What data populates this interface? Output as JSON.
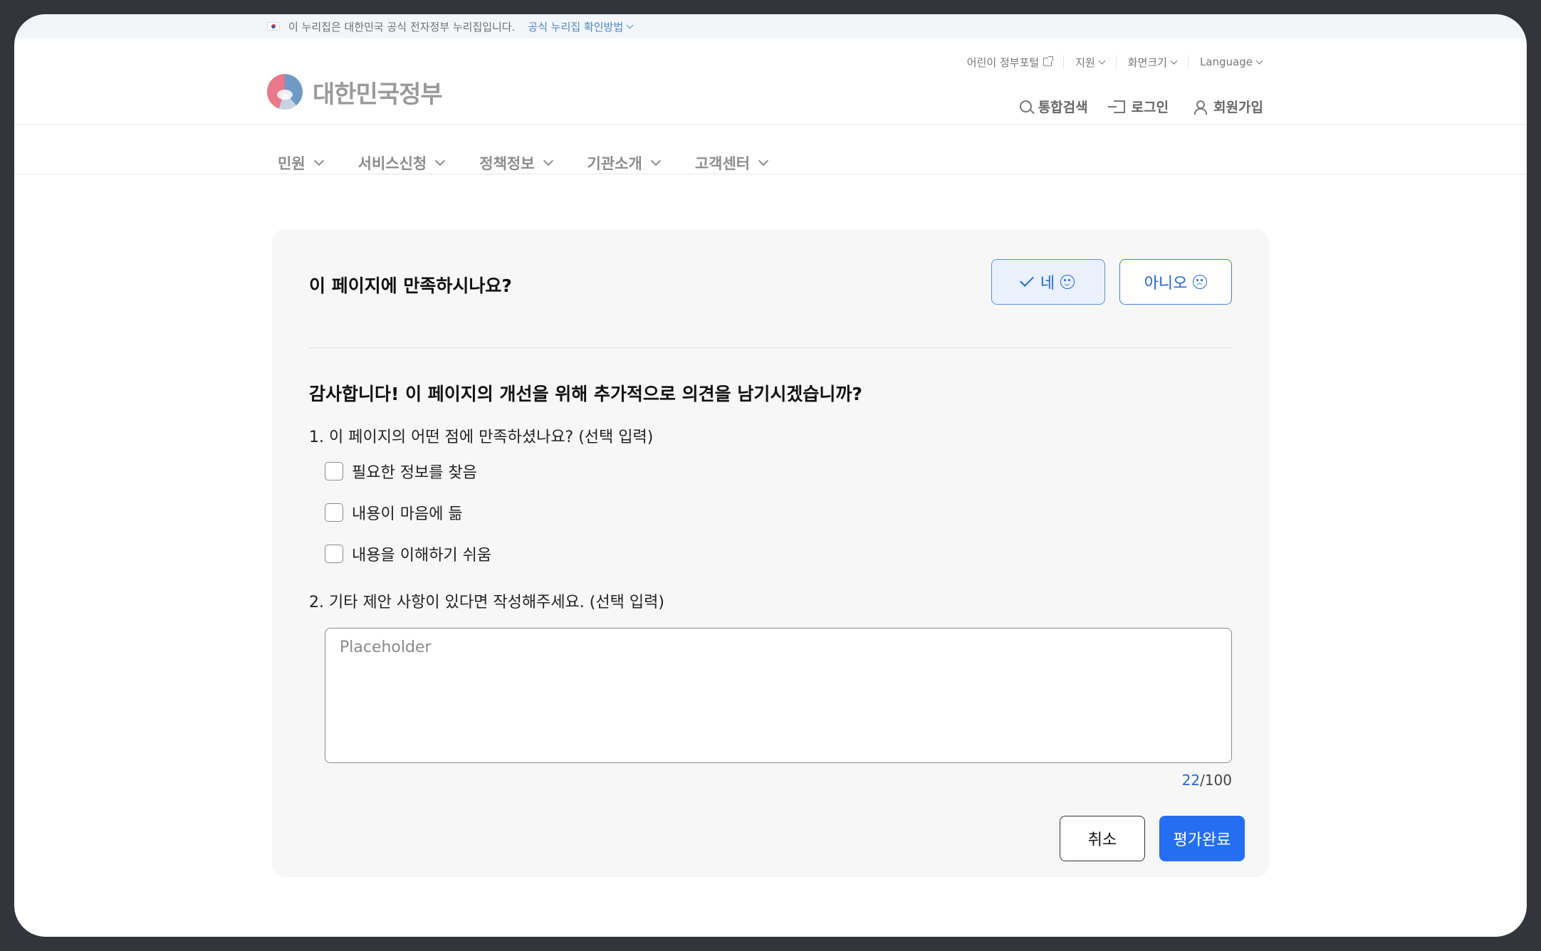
{
  "gov_bar": {
    "notice": "이 누리집은 대한민국 공식 전자정부 누리집입니다.",
    "verify_link": "공식 누리집 확인방법"
  },
  "utility": [
    {
      "label": "어린이 정부포털",
      "icon": "external-link-icon"
    },
    {
      "label": "지원",
      "icon": "chevron-down-icon"
    },
    {
      "label": "화면크기",
      "icon": "chevron-down-icon"
    },
    {
      "label": "Language",
      "icon": "chevron-down-icon"
    }
  ],
  "header": {
    "logo_text": "대한민국정부",
    "actions": [
      {
        "label": "통합검색",
        "icon": "search-icon"
      },
      {
        "label": "로그인",
        "icon": "login-icon"
      },
      {
        "label": "회원가입",
        "icon": "user-add-icon"
      }
    ]
  },
  "nav": [
    {
      "label": "민원"
    },
    {
      "label": "서비스신청"
    },
    {
      "label": "정책정보"
    },
    {
      "label": "기관소개"
    },
    {
      "label": "고객센터"
    }
  ],
  "feedback": {
    "question": "이 페이지에 만족하시나요?",
    "yes_label": "네",
    "no_label": "아니오",
    "thanks": "감사합니다! 이 페이지의 개선을 위해 추가적으로 의견을 남기시겠습니까?",
    "q1": "1. 이 페이지의 어떤 점에 만족하셨나요? (선택 입력)",
    "options": [
      {
        "label": "필요한 정보를 찾음",
        "checked": false
      },
      {
        "label": "내용이 마음에 듦",
        "checked": false
      },
      {
        "label": "내용을 이해하기 쉬움",
        "checked": false
      }
    ],
    "q2": "2. 기타 제안 사항이 있다면 작성해주세요. (선택 입력)",
    "textarea_placeholder": "Placeholder",
    "textarea_value": "",
    "counter_current": "22",
    "counter_max": "/100",
    "cancel_label": "취소",
    "submit_label": "평가완료"
  },
  "colors": {
    "accent": "#256ef1",
    "accent_text": "#2167d4",
    "card_bg": "#f7f7f7",
    "frame": "#34353c"
  }
}
